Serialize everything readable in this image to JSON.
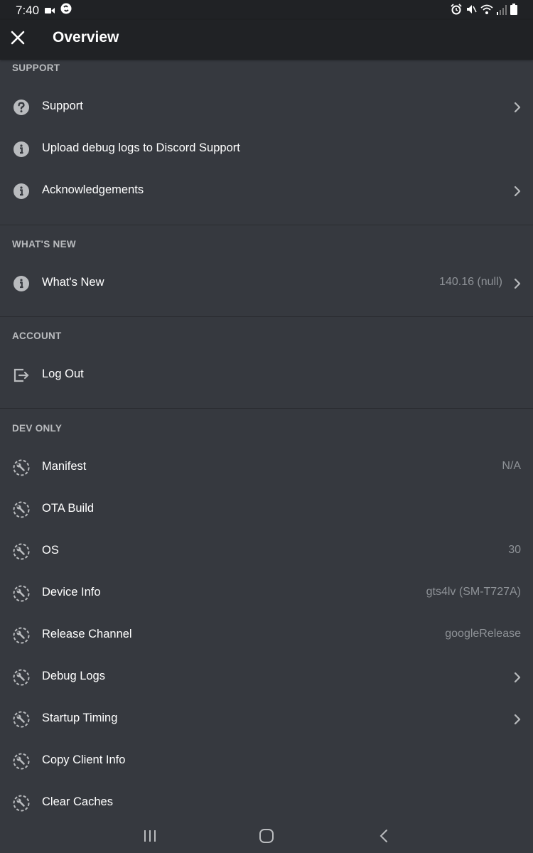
{
  "status_bar": {
    "time": "7:40"
  },
  "header": {
    "title": "Overview"
  },
  "sections": [
    {
      "title": "SUPPORT",
      "items": [
        {
          "label": "Support",
          "icon": "help-circle-icon",
          "value": "",
          "chevron": true
        },
        {
          "label": "Upload debug logs to Discord Support",
          "icon": "info-icon",
          "value": "",
          "chevron": false
        },
        {
          "label": "Acknowledgements",
          "icon": "info-icon",
          "value": "",
          "chevron": true
        }
      ]
    },
    {
      "title": "WHAT'S NEW",
      "items": [
        {
          "label": "What's New",
          "icon": "info-icon",
          "value": "140.16 (null)",
          "chevron": true
        }
      ]
    },
    {
      "title": "ACCOUNT",
      "items": [
        {
          "label": "Log Out",
          "icon": "logout-icon",
          "value": "",
          "chevron": false
        }
      ]
    },
    {
      "title": "DEV ONLY",
      "items": [
        {
          "label": "Manifest",
          "icon": "wrench-icon",
          "value": "N/A",
          "chevron": false
        },
        {
          "label": "OTA Build",
          "icon": "wrench-icon",
          "value": "",
          "chevron": false
        },
        {
          "label": "OS",
          "icon": "wrench-icon",
          "value": "30",
          "chevron": false
        },
        {
          "label": "Device Info",
          "icon": "wrench-icon",
          "value": "gts4lv (SM-T727A)",
          "chevron": false
        },
        {
          "label": "Release Channel",
          "icon": "wrench-icon",
          "value": "googleRelease",
          "chevron": false
        },
        {
          "label": "Debug Logs",
          "icon": "wrench-icon",
          "value": "",
          "chevron": true
        },
        {
          "label": "Startup Timing",
          "icon": "wrench-icon",
          "value": "",
          "chevron": true
        },
        {
          "label": "Copy Client Info",
          "icon": "wrench-icon",
          "value": "",
          "chevron": false
        },
        {
          "label": "Clear Caches",
          "icon": "wrench-icon",
          "value": "",
          "chevron": false
        }
      ]
    }
  ],
  "colors": {
    "background": "#36393f",
    "header_bg": "#202225",
    "section_text": "#b9bbbe",
    "value_text": "#8e9297",
    "icon": "#b9bbbe"
  }
}
